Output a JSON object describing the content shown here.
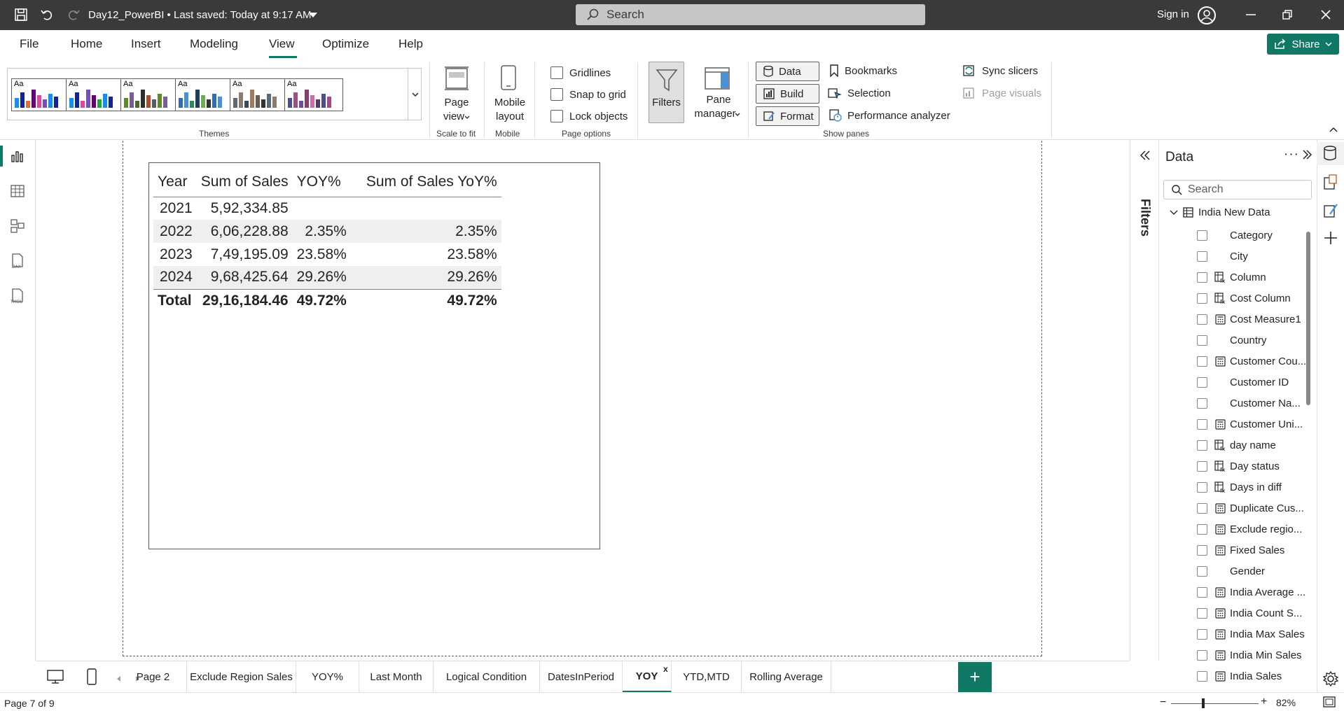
{
  "titlebar": {
    "title": "Day12_PowerBI • Last saved: Today at 9:17 AM",
    "search_placeholder": "Search",
    "signin": "Sign in"
  },
  "menu": [
    "File",
    "Home",
    "Insert",
    "Modeling",
    "View",
    "Optimize",
    "Help"
  ],
  "share": "Share",
  "ribbon": {
    "themes_label": "Themes",
    "theme_aa": "Aa",
    "page_view": "Page\nview",
    "page_view_line1": "Page",
    "page_view_line2": "view",
    "scale_label": "Scale to fit",
    "mobile_line1": "Mobile",
    "mobile_line2": "layout",
    "mobile_group": "Mobile",
    "gridlines": "Gridlines",
    "snap": "Snap to grid",
    "lock": "Lock objects",
    "page_options": "Page options",
    "filters": "Filters",
    "pane_line1": "Pane",
    "pane_line2": "manager",
    "data": "Data",
    "build": "Build",
    "format": "Format",
    "bookmarks": "Bookmarks",
    "selection": "Selection",
    "performance": "Performance analyzer",
    "sync": "Sync slicers",
    "page_visuals": "Page visuals",
    "show_panes": "Show panes"
  },
  "table": {
    "headers": [
      "Year",
      "Sum of Sales",
      "YOY%",
      "Sum of Sales YoY%"
    ],
    "rows": [
      [
        "2021",
        "5,92,334.85",
        "",
        ""
      ],
      [
        "2022",
        "6,06,228.88",
        "2.35%",
        "2.35%"
      ],
      [
        "2023",
        "7,49,195.09",
        "23.58%",
        "23.58%"
      ],
      [
        "2024",
        "9,68,425.64",
        "29.26%",
        "29.26%"
      ]
    ],
    "total": [
      "Total",
      "29,16,184.46",
      "49.72%",
      "49.72%"
    ]
  },
  "filters_label": "Filters",
  "data_pane": {
    "title": "Data",
    "search_placeholder": "Search",
    "table_name": "India New Data",
    "fields": [
      {
        "name": "Category",
        "icon": "none"
      },
      {
        "name": "City",
        "icon": "none"
      },
      {
        "name": "Column",
        "icon": "calc-column"
      },
      {
        "name": "Cost Column",
        "icon": "calc-column"
      },
      {
        "name": "Cost Measure1",
        "icon": "measure"
      },
      {
        "name": "Country",
        "icon": "none"
      },
      {
        "name": "Customer Cou...",
        "icon": "measure"
      },
      {
        "name": "Customer ID",
        "icon": "none"
      },
      {
        "name": "Customer Na...",
        "icon": "none"
      },
      {
        "name": "Customer Uni...",
        "icon": "measure"
      },
      {
        "name": "day name",
        "icon": "calc-column"
      },
      {
        "name": "Day status",
        "icon": "calc-column"
      },
      {
        "name": "Days in diff",
        "icon": "calc-column"
      },
      {
        "name": "Duplicate Cus...",
        "icon": "measure"
      },
      {
        "name": "Exclude regio...",
        "icon": "measure"
      },
      {
        "name": "Fixed Sales",
        "icon": "measure"
      },
      {
        "name": "Gender",
        "icon": "none"
      },
      {
        "name": "India Average ...",
        "icon": "measure"
      },
      {
        "name": "India Count S...",
        "icon": "measure"
      },
      {
        "name": "India Max Sales",
        "icon": "measure"
      },
      {
        "name": "India Min Sales",
        "icon": "measure"
      },
      {
        "name": "India Sales",
        "icon": "measure"
      }
    ]
  },
  "tabs": [
    "Page 2",
    "Exclude Region Sales",
    "YOY%",
    "Last Month",
    "Logical Condition",
    "DatesInPeriod",
    "YOY",
    "YTD,MTD",
    "Rolling Average"
  ],
  "active_tab": "YOY",
  "tab_close": "x",
  "add_page": "+",
  "status": {
    "page": "Page 7 of 9",
    "zoom": "82%"
  },
  "colors": {
    "accent": "#117865",
    "titlebar": "#3b3a39",
    "table_rule": "#4a90d9"
  }
}
